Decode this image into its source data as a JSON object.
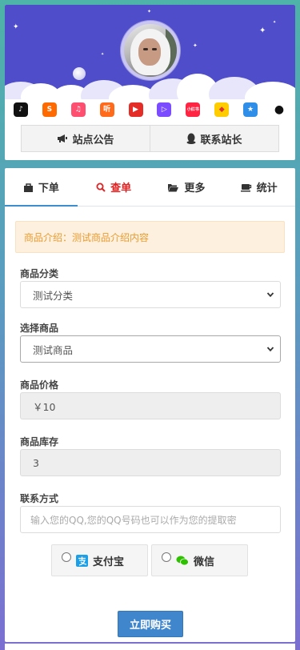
{
  "header": {
    "notice_button": "站点公告",
    "contact_button": "联系站长",
    "apps": [
      {
        "name": "douyin-icon",
        "bg": "#111111",
        "glyph": "♪"
      },
      {
        "name": "kugou-icon",
        "bg": "#ff6a00",
        "glyph": "S"
      },
      {
        "name": "music-icon",
        "bg": "#ff4f70",
        "glyph": "♫"
      },
      {
        "name": "ting-icon",
        "bg": "#ff6b1a",
        "glyph": "听"
      },
      {
        "name": "video-icon",
        "bg": "#e52d27",
        "glyph": "▶"
      },
      {
        "name": "player-icon",
        "bg": "#7a4bff",
        "glyph": "▷"
      },
      {
        "name": "xiaohongshu-icon",
        "bg": "#ff2442",
        "glyph": "小红书"
      },
      {
        "name": "game-icon",
        "bg": "#ffcc00",
        "glyph": "◆"
      },
      {
        "name": "star-icon",
        "bg": "#2f8fe8",
        "glyph": "★"
      },
      {
        "name": "qq-icon",
        "bg": "#ffffff",
        "glyph": "●"
      }
    ]
  },
  "tabs": [
    {
      "label": "下单",
      "icon": "bag-icon"
    },
    {
      "label": "查单",
      "icon": "search-icon"
    },
    {
      "label": "更多",
      "icon": "folder-icon"
    },
    {
      "label": "统计",
      "icon": "cup-icon"
    }
  ],
  "notice": "商品介绍：测试商品介绍内容",
  "form": {
    "category_label": "商品分类",
    "category_value": "测试分类",
    "product_label": "选择商品",
    "product_value": "测试商品",
    "price_label": "商品价格",
    "price_value": "￥10",
    "stock_label": "商品库存",
    "stock_value": "3",
    "contact_label": "联系方式",
    "contact_placeholder": "输入您的QQ,您的QQ号码也可以作为您的提取密"
  },
  "payment": [
    {
      "label": "支付宝",
      "icon": "alipay-icon",
      "color": "#1a9fe8"
    },
    {
      "label": "微信",
      "icon": "wechat-icon",
      "color": "#2dc100"
    }
  ],
  "buy_button": "立即购买"
}
